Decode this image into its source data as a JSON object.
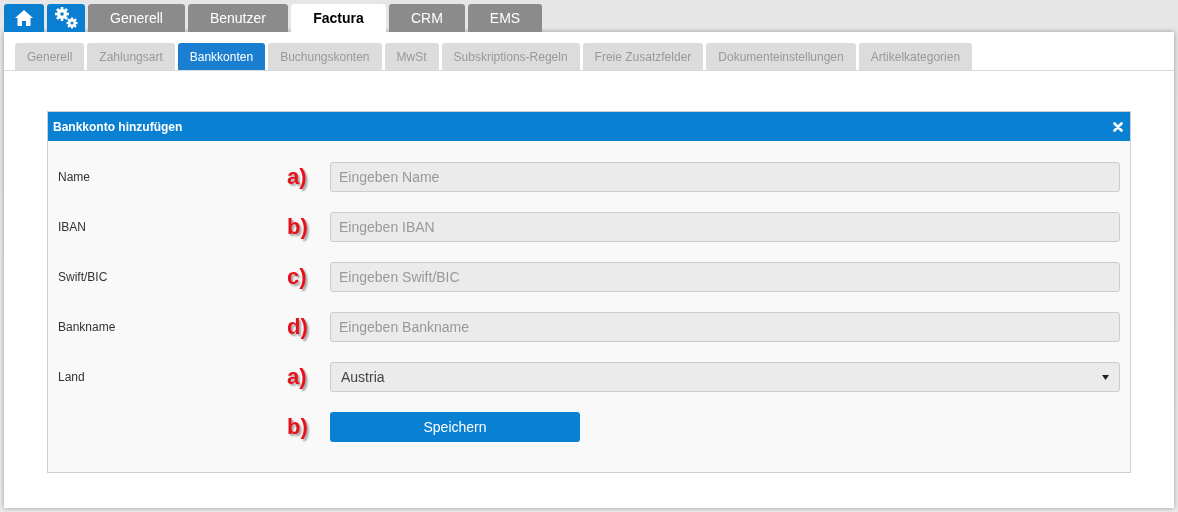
{
  "main_tabs": [
    {
      "label": "Generell",
      "selected": false
    },
    {
      "label": "Benutzer",
      "selected": false
    },
    {
      "label": "Factura",
      "selected": true
    },
    {
      "label": "CRM",
      "selected": false
    },
    {
      "label": "EMS",
      "selected": false
    }
  ],
  "sub_tabs": [
    {
      "label": "Generell",
      "selected": false
    },
    {
      "label": "Zahlungsart",
      "selected": false
    },
    {
      "label": "Bankkonten",
      "selected": true
    },
    {
      "label": "Buchungskonten",
      "selected": false
    },
    {
      "label": "MwSt",
      "selected": false
    },
    {
      "label": "Subskriptions-Regeln",
      "selected": false
    },
    {
      "label": "Freie Zusatzfelder",
      "selected": false
    },
    {
      "label": "Dokumenteinstellungen",
      "selected": false
    },
    {
      "label": "Artikelkategorien",
      "selected": false
    }
  ],
  "dialog": {
    "title": "Bankkonto hinzufügen",
    "fields": [
      {
        "kind": "text",
        "label": "Name",
        "marker": "a)",
        "placeholder": "Eingeben Name"
      },
      {
        "kind": "text",
        "label": "IBAN",
        "marker": "b)",
        "placeholder": "Eingeben IBAN"
      },
      {
        "kind": "text",
        "label": "Swift/BIC",
        "marker": "c)",
        "placeholder": "Eingeben Swift/BIC"
      },
      {
        "kind": "text",
        "label": "Bankname",
        "marker": "d)",
        "placeholder": "Eingeben Bankname"
      },
      {
        "kind": "select",
        "label": "Land",
        "marker": "a)",
        "value": "Austria"
      }
    ],
    "submit": {
      "marker": "b)",
      "label": "Speichern"
    }
  }
}
